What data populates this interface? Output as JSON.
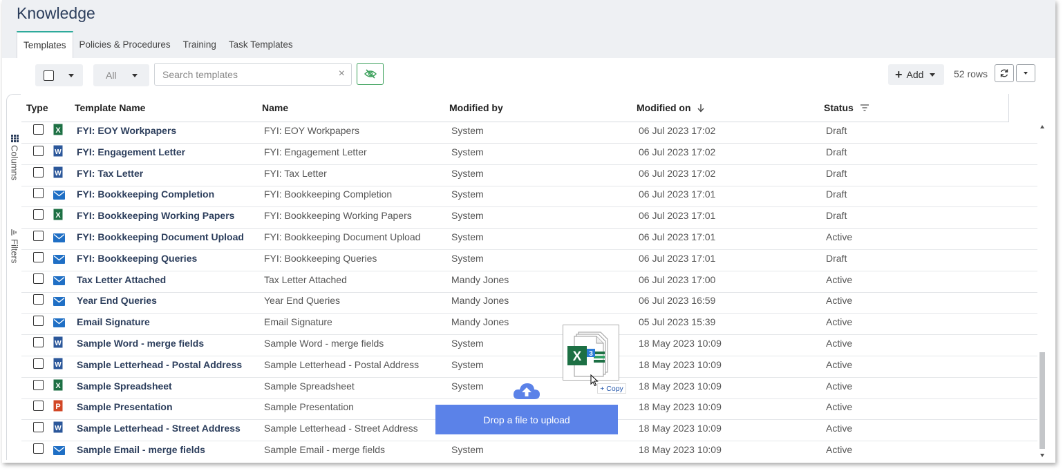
{
  "page": {
    "title": "Knowledge"
  },
  "tabs": [
    {
      "label": "Templates",
      "active": true
    },
    {
      "label": "Policies & Procedures",
      "active": false
    },
    {
      "label": "Training",
      "active": false
    },
    {
      "label": "Task Templates",
      "active": false
    }
  ],
  "toolbar": {
    "filter_value": "All",
    "search_placeholder": "Search templates",
    "clear_icon": "×",
    "add_label": "Add",
    "rows_count": "52 rows",
    "visibility_icon": "eye-off-icon",
    "refresh_icon": "refresh-icon"
  },
  "side_panel": {
    "columns_label": "Columns",
    "filters_label": "Filters"
  },
  "table": {
    "headers": {
      "type": "Type",
      "template_name": "Template Name",
      "name": "Name",
      "modified_by": "Modified by",
      "modified_on": "Modified on",
      "status": "Status"
    },
    "sort": {
      "column": "Modified on",
      "direction": "descending"
    },
    "rows": [
      {
        "type": "excel",
        "template_name": "FYI: EOY Workpapers",
        "name": "FYI: EOY Workpapers",
        "modified_by": "System",
        "modified_on": "06 Jul 2023 17:02",
        "status": "Draft"
      },
      {
        "type": "word",
        "template_name": "FYI: Engagement Letter",
        "name": "FYI: Engagement Letter",
        "modified_by": "System",
        "modified_on": "06 Jul 2023 17:02",
        "status": "Draft"
      },
      {
        "type": "word",
        "template_name": "FYI: Tax Letter",
        "name": "FYI: Tax Letter",
        "modified_by": "System",
        "modified_on": "06 Jul 2023 17:02",
        "status": "Draft"
      },
      {
        "type": "email",
        "template_name": "FYI: Bookkeeping Completion",
        "name": "FYI: Bookkeeping Completion",
        "modified_by": "System",
        "modified_on": "06 Jul 2023 17:01",
        "status": "Draft"
      },
      {
        "type": "excel",
        "template_name": "FYI: Bookkeeping Working Papers",
        "name": "FYI: Bookkeeping Working Papers",
        "modified_by": "System",
        "modified_on": "06 Jul 2023 17:01",
        "status": "Draft"
      },
      {
        "type": "email",
        "template_name": "FYI: Bookkeeping Document Upload",
        "name": "FYI: Bookkeeping Document Upload",
        "modified_by": "System",
        "modified_on": "06 Jul 2023 17:01",
        "status": "Active"
      },
      {
        "type": "email",
        "template_name": "FYI: Bookkeeping Queries",
        "name": "FYI: Bookkeeping Queries",
        "modified_by": "System",
        "modified_on": "06 Jul 2023 17:01",
        "status": "Draft"
      },
      {
        "type": "email",
        "template_name": "Tax Letter Attached",
        "name": "Tax Letter Attached",
        "modified_by": "Mandy Jones",
        "modified_on": "06 Jul 2023 17:00",
        "status": "Active"
      },
      {
        "type": "email",
        "template_name": "Year End Queries",
        "name": "Year End Queries",
        "modified_by": "Mandy Jones",
        "modified_on": "06 Jul 2023 16:59",
        "status": "Active"
      },
      {
        "type": "email",
        "template_name": "Email Signature",
        "name": "Email Signature",
        "modified_by": "Mandy Jones",
        "modified_on": "05 Jul 2023 15:39",
        "status": "Active"
      },
      {
        "type": "word",
        "template_name": "Sample Word - merge fields",
        "name": "Sample Word - merge fields",
        "modified_by": "System",
        "modified_on": "18 May 2023 10:09",
        "status": "Active"
      },
      {
        "type": "word",
        "template_name": "Sample Letterhead - Postal Address",
        "name": "Sample Letterhead - Postal Address",
        "modified_by": "System",
        "modified_on": "18 May 2023 10:09",
        "status": "Active"
      },
      {
        "type": "excel",
        "template_name": "Sample Spreadsheet",
        "name": "Sample Spreadsheet",
        "modified_by": "System",
        "modified_on": "18 May 2023 10:09",
        "status": "Active"
      },
      {
        "type": "powerpoint",
        "template_name": "Sample Presentation",
        "name": "Sample Presentation",
        "modified_by": "",
        "modified_on": "18 May 2023 10:09",
        "status": "Active"
      },
      {
        "type": "word",
        "template_name": "Sample Letterhead - Street Address",
        "name": "Sample Letterhead - Street Address",
        "modified_by": "",
        "modified_on": "18 May 2023 10:09",
        "status": "Active"
      },
      {
        "type": "email",
        "template_name": "Sample Email - merge fields",
        "name": "Sample Email - merge fields",
        "modified_by": "System",
        "modified_on": "18 May 2023 10:09",
        "status": "Active"
      }
    ]
  },
  "drag_overlay": {
    "copy_label": "+ Copy",
    "drop_label": "Drop a file to upload",
    "file_icon": "excel-file-icon"
  },
  "colors": {
    "accent_tab": "#2eaa9b",
    "link_text": "#2c3e5c",
    "drop_zone": "#5b82e8",
    "excel": "#1d7044",
    "word": "#2b579a",
    "email": "#1f6fc5",
    "powerpoint": "#d24726"
  }
}
